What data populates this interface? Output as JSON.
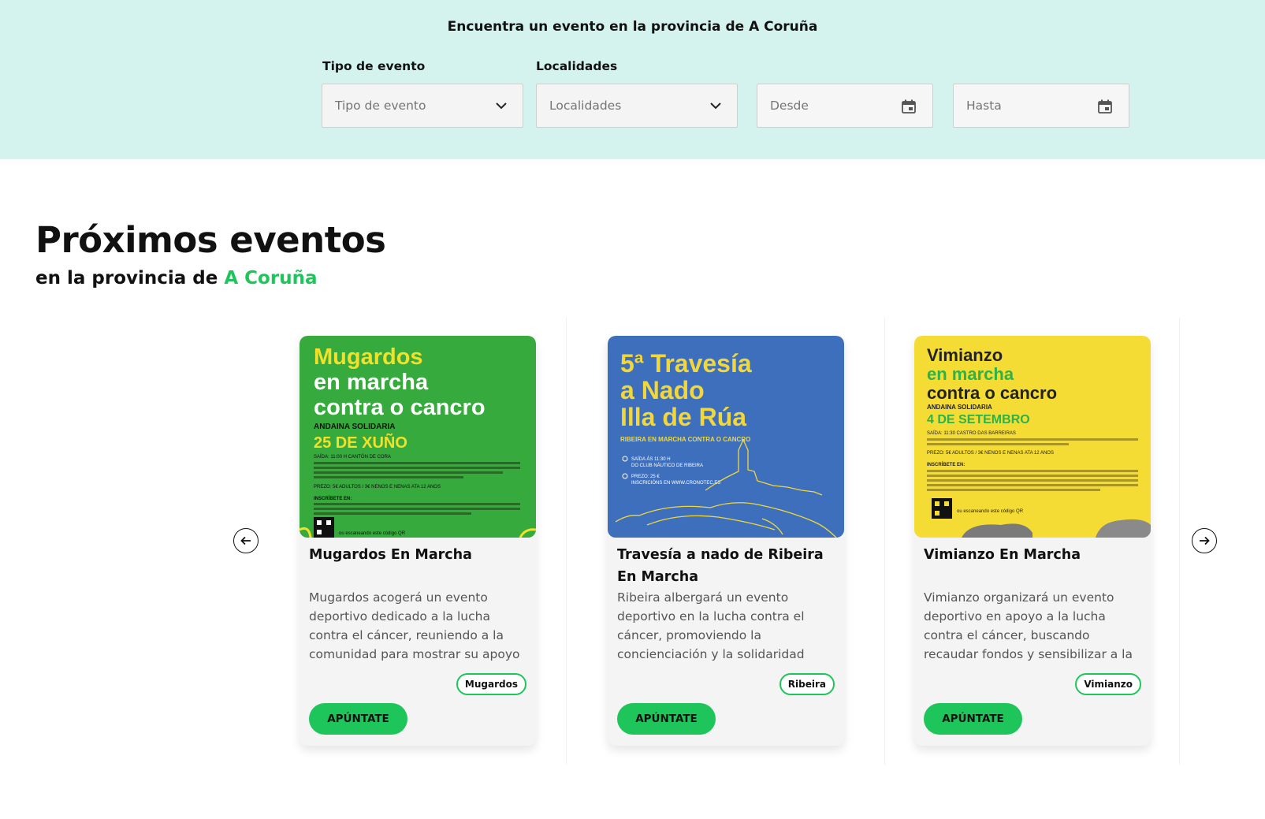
{
  "filters": {
    "heading": "Encuentra un evento en la provincia de A Coruña",
    "type_label": "Tipo de evento",
    "type_placeholder": "Tipo de evento",
    "locality_label": "Localidades",
    "locality_placeholder": "Localidades",
    "from_placeholder": "Desde",
    "to_placeholder": "Hasta"
  },
  "section": {
    "title": "Próximos eventos",
    "subtitle_prefix": "en la provincia de ",
    "subtitle_accent": "A Coruña"
  },
  "events": [
    {
      "title": "Mugardos En Marcha",
      "description": "Mugardos acogerá un evento deportivo dedicado a la lucha contra el cáncer, reuniendo a la comunidad para mostrar su apoyo y solidaridad...",
      "tag": "Mugardos",
      "cta": "APÚNTATE",
      "poster": {
        "bg": "#36aa3c",
        "line1": "Mugardos",
        "line2": "en marcha",
        "line3": "contra o cancro",
        "kicker": "ANDAINA SOLIDARIA",
        "date": "25 DE XUÑO",
        "accent": "#f2e02a",
        "small1": "SAÍDA: 11:00 H CANTÓN DE CORA",
        "small2": "PREZO: 5€ ADULTOS / 3€ NENOS E NENAS ATA 12 ANOS",
        "small3": "INSCRÍBETE EN:",
        "small4": "ou escaneando este código QR"
      }
    },
    {
      "title": "Travesía a nado de Ribeira En Marcha",
      "description": "Ribeira albergará un evento deportivo en la lucha contra el cáncer, promoviendo la concienciación y la solidaridad para...",
      "tag": "Ribeira",
      "cta": "APÚNTATE",
      "poster": {
        "bg": "#3d6fbd",
        "line1": "5ª Travesía",
        "line2": "a Nado",
        "line3": "Illa de Rúa",
        "accent": "#f2d73a",
        "band": "RIBEIRA EN MARCHA CONTRA O CANCRO",
        "small1": "SAÍDA ÁS 11:30 H",
        "small2": "DO CLUB NÁUTICO DE RIBEIRA",
        "small3": "PREZO: 25 €",
        "small4": "INSCRICIÓNS EN WWW.CRONOTEC.ES"
      }
    },
    {
      "title": "Vimianzo En Marcha",
      "description": "Vimianzo organizará un evento deportivo en apoyo a la lucha contra el cáncer, buscando recaudar fondos y sensibilizar a la comunidad sobre l...",
      "tag": "Vimianzo",
      "cta": "APÚNTATE",
      "poster": {
        "bg": "#f4dc35",
        "line1": "Vimianzo",
        "line2": "en marcha",
        "line3": "contra o cancro",
        "kicker": "ANDAINA SOLIDARIA",
        "date": "4 DE SETEMBRO",
        "accent": "#2bb34a",
        "small1": "SAÍDA: 11:30 CASTRO DAS BARREIRAS",
        "small2": "PREZO: 5€ ADULTOS / 3€ NENOS E NENAS ATA 12 ANOS",
        "small3": "INSCRÍBETE EN:",
        "small4": "ou escaneando este código QR"
      }
    }
  ],
  "icons": {
    "prev": "arrow-left-icon",
    "next": "arrow-right-icon",
    "chevron": "chevron-down-icon",
    "calendar": "calendar-icon"
  },
  "colors": {
    "band": "#d4f3ee",
    "accent_green": "#1ec55a"
  }
}
